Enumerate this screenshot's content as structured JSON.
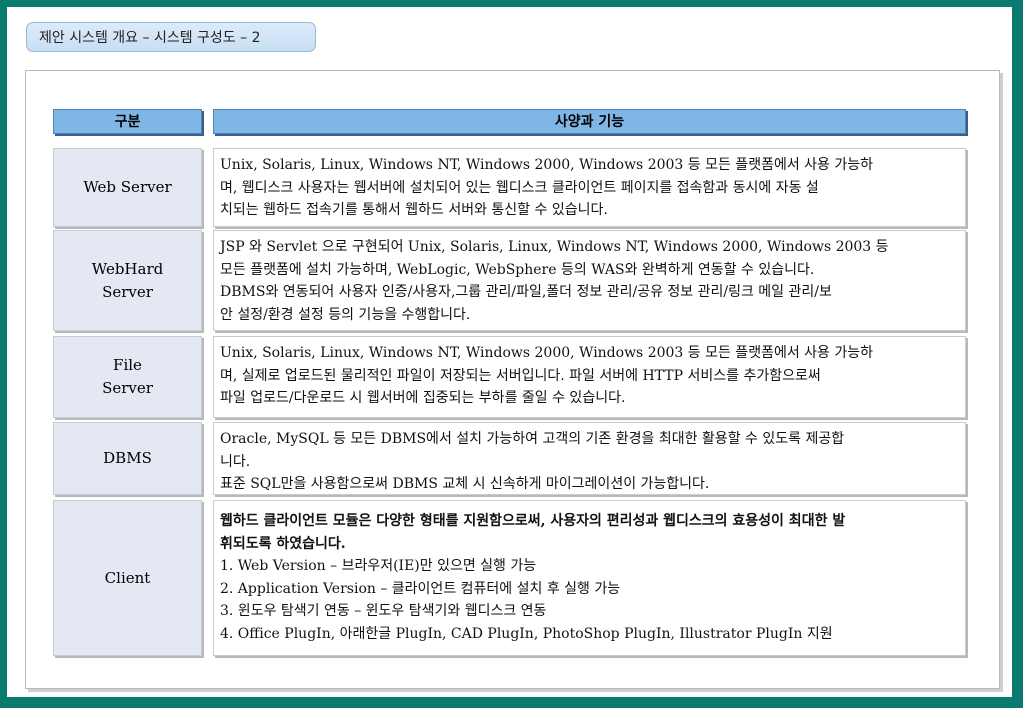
{
  "title": "제안 시스템 개요 – 시스템 구성도 – 2",
  "headers": {
    "col1": "구분",
    "col2": "사양과 기능"
  },
  "rows": [
    {
      "label": "Web Server",
      "lines": [
        "Unix, Solaris, Linux, Windows NT, Windows 2000, Windows 2003 등 모든 플랫폼에서 사용 가능하",
        "며, 웹디스크 사용자는 웹서버에 설치되어 있는 웹디스크 클라이언트 페이지를 접속함과 동시에 자동 설",
        "치되는 웹하드 접속기를 통해서 웹하드 서버와 통신할 수 있습니다."
      ]
    },
    {
      "label": "WebHard\nServer",
      "lines": [
        "JSP 와 Servlet 으로 구현되어 Unix, Solaris, Linux, Windows NT, Windows 2000, Windows 2003 등",
        "모든 플랫폼에 설치 가능하며, WebLogic, WebSphere 등의 WAS와 완벽하게 연동할 수 있습니다.",
        "DBMS와 연동되어 사용자 인증/사용자,그룹 관리/파일,폴더 정보 관리/공유 정보 관리/링크 메일 관리/보",
        "안 설정/환경 설정 등의 기능을 수행합니다."
      ]
    },
    {
      "label": "File\nServer",
      "lines": [
        "Unix, Solaris, Linux, Windows NT, Windows 2000, Windows 2003 등 모든 플랫폼에서 사용 가능하",
        "며, 실제로 업로드된 물리적인 파일이 저장되는 서버입니다. 파일 서버에 HTTP 서비스를 추가함으로써",
        "파일 업로드/다운로드 시 웹서버에 집중되는 부하를 줄일 수 있습니다."
      ]
    },
    {
      "label": "DBMS",
      "lines": [
        "Oracle, MySQL 등 모든 DBMS에서 설치 가능하여 고객의 기존 환경을 최대한 활용할 수 있도록 제공합",
        "니다.",
        "표준 SQL만을 사용함으로써 DBMS 교체 시 신속하게 마이그레이션이 가능합니다."
      ]
    },
    {
      "label": "Client",
      "bold_lines": [
        "웹하드 클라이언트 모듈은 다양한 형태를 지원함으로써, 사용자의 편리성과 웹디스크의 효용성이 최대한 발",
        "휘되도록 하였습니다."
      ],
      "lines": [
        "1. Web Version – 브라우저(IE)만 있으면 실행 가능",
        "2. Application Version – 클라이언트 컴퓨터에 설치 후 실행 가능",
        "3. 윈도우 탐색기 연동 – 윈도우 탐색기와 웹디스크 연동",
        "4. Office PlugIn, 아래한글 PlugIn, CAD PlugIn, PhotoShop PlugIn, Illustrator PlugIn 지원"
      ]
    }
  ]
}
